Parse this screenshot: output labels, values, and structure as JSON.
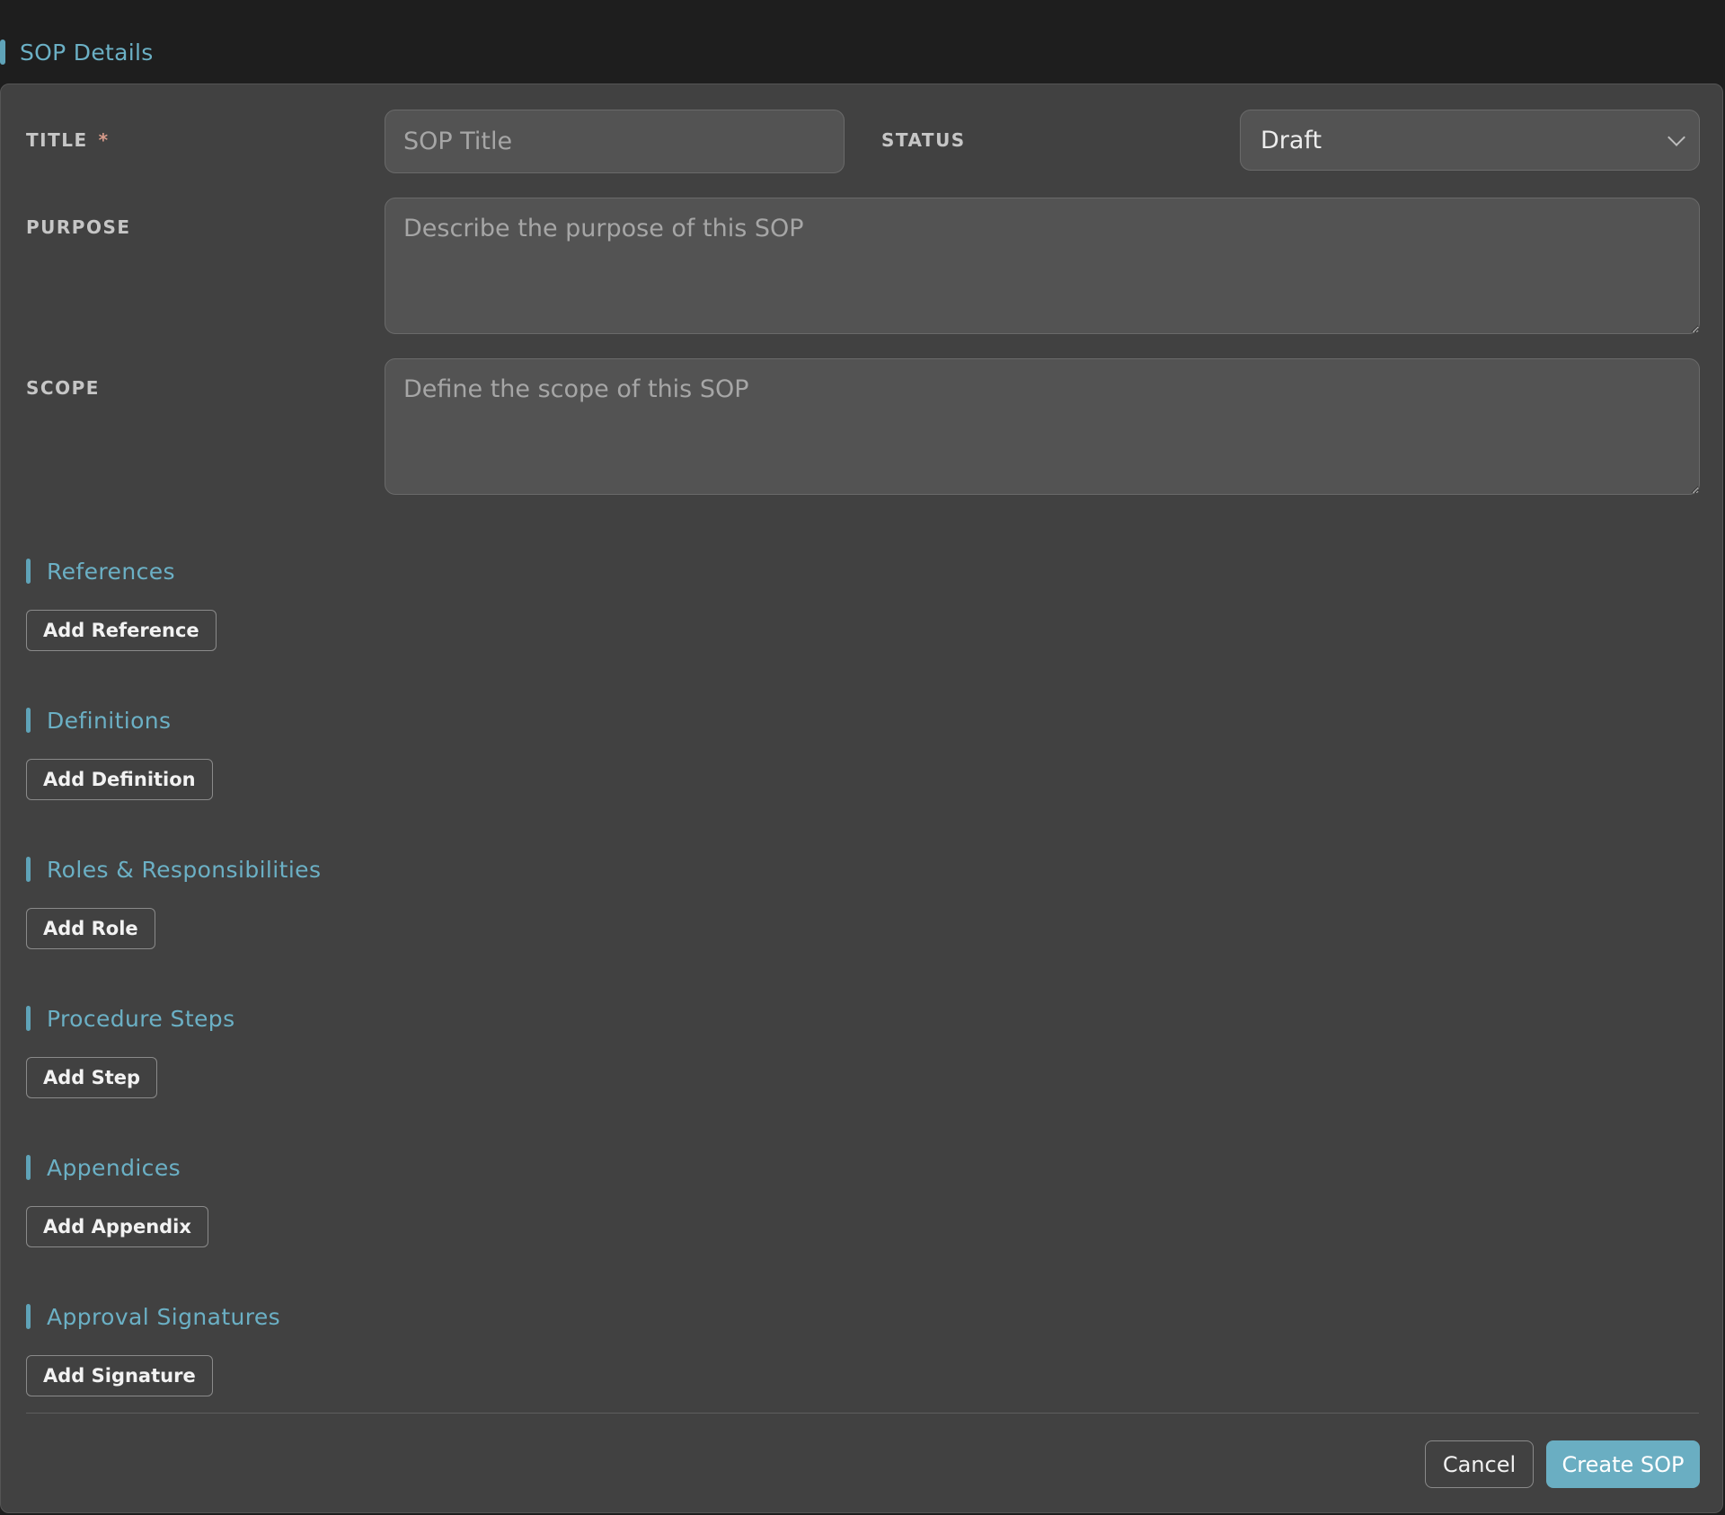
{
  "header": {
    "title": "SOP Details"
  },
  "form": {
    "title_label": "TITLE",
    "required_mark": "*",
    "title_placeholder": "SOP Title",
    "status_label": "STATUS",
    "status_value": "Draft",
    "purpose_label": "PURPOSE",
    "purpose_placeholder": "Describe the purpose of this SOP",
    "scope_label": "SCOPE",
    "scope_placeholder": "Define the scope of this SOP"
  },
  "sections": {
    "references": {
      "title": "References",
      "button": "Add Reference"
    },
    "definitions": {
      "title": "Definitions",
      "button": "Add Definition"
    },
    "roles": {
      "title": "Roles & Responsibilities",
      "button": "Add Role"
    },
    "steps": {
      "title": "Procedure Steps",
      "button": "Add Step"
    },
    "appendices": {
      "title": "Appendices",
      "button": "Add Appendix"
    },
    "signatures": {
      "title": "Approval Signatures",
      "button": "Add Signature"
    }
  },
  "footer": {
    "cancel_label": "Cancel",
    "create_label": "Create SOP"
  },
  "colors": {
    "accent": "#6aaec2",
    "panel": "#414141",
    "background": "#1e1e1e"
  }
}
